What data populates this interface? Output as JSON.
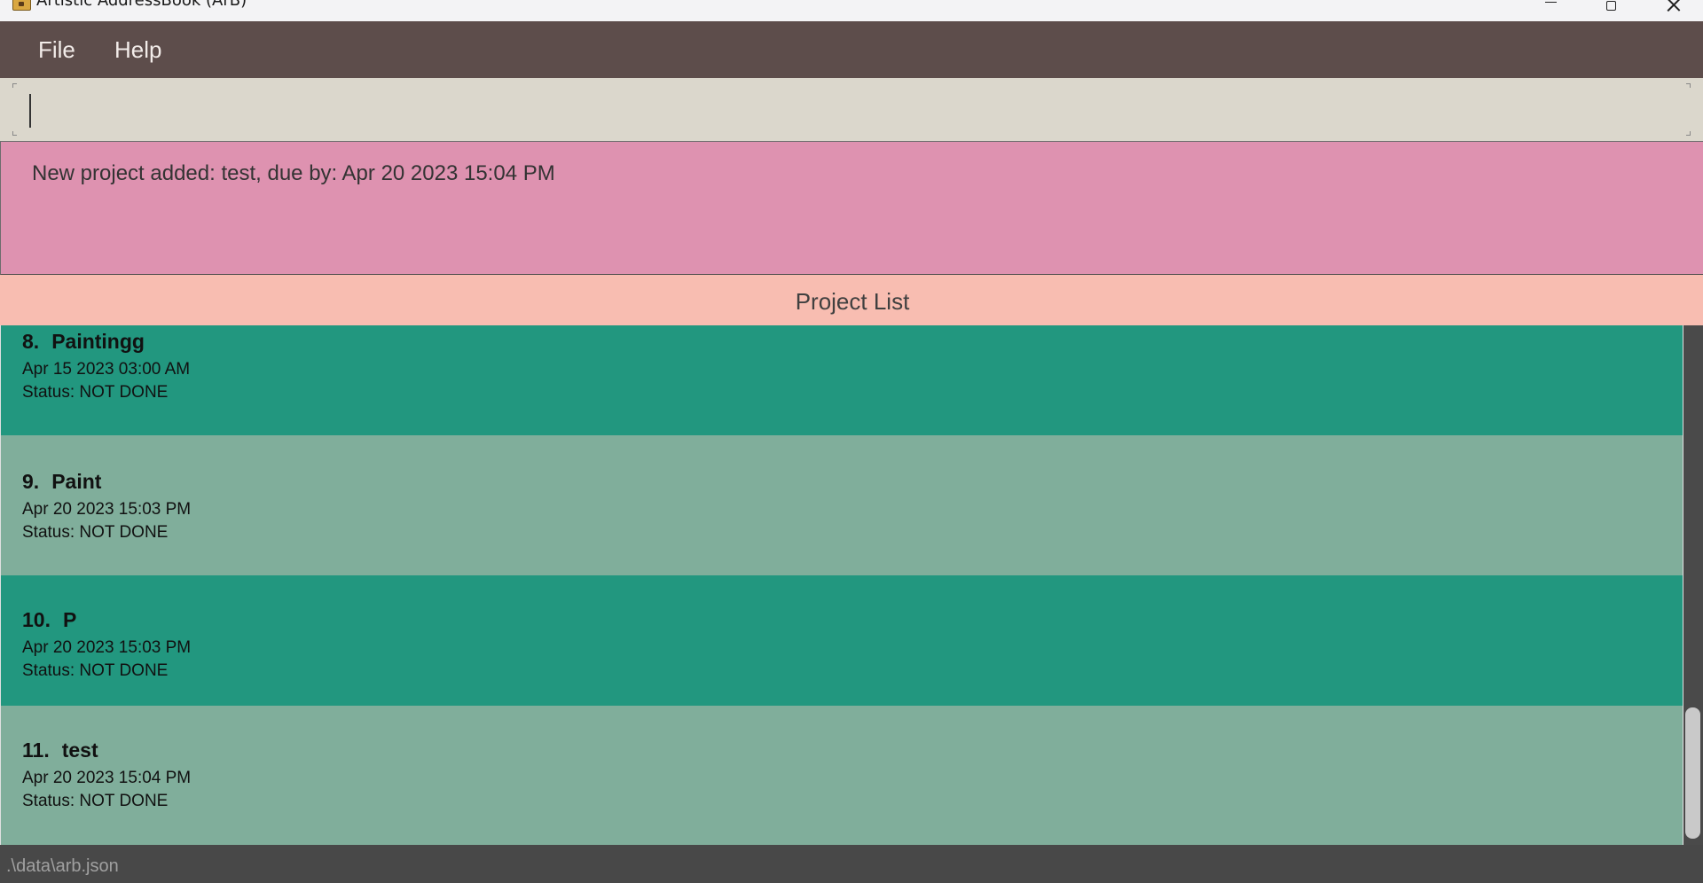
{
  "window": {
    "title": "Artistic AddressBook (ArB)",
    "controls": {
      "minimize_icon": "minimize-icon",
      "maximize_icon": "maximize-icon",
      "close_icon": "close-icon"
    }
  },
  "menu": {
    "items": [
      {
        "label": "File"
      },
      {
        "label": "Help"
      }
    ]
  },
  "command": {
    "value": "",
    "placeholder": ""
  },
  "result": {
    "message": "New project added: test, due by: Apr 20 2023 15:04 PM"
  },
  "project_list": {
    "title": "Project List",
    "projects": [
      {
        "index": "8.",
        "name": "Paintingg",
        "deadline": "Apr 15 2023 03:00 AM",
        "status": "Status: NOT DONE"
      },
      {
        "index": "9.",
        "name": "Paint",
        "deadline": "Apr 20 2023 15:03 PM",
        "status": "Status: NOT DONE"
      },
      {
        "index": "10.",
        "name": "P",
        "deadline": "Apr 20 2023 15:03 PM",
        "status": "Status: NOT DONE"
      },
      {
        "index": "11.",
        "name": "test",
        "deadline": "Apr 20 2023 15:04 PM",
        "status": "Status: NOT DONE"
      }
    ]
  },
  "status_bar": {
    "path": ".\\data\\arb.json"
  },
  "colors": {
    "menu_bar": "#5d4d4b",
    "command_box": "#dbd7cc",
    "result_box": "#de92b0",
    "list_header": "#f8bdb1",
    "card_dark": "#22977f",
    "card_light": "#80ae9b",
    "status_bar": "#484848"
  }
}
